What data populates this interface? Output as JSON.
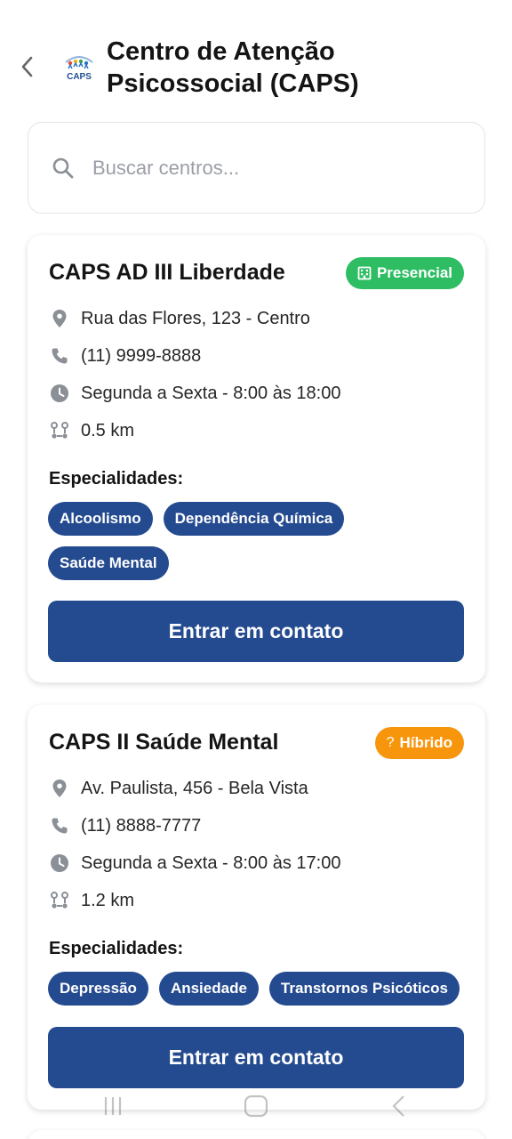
{
  "header": {
    "title": "Centro de Atenção Psicossocial (CAPS)",
    "logo_text": "CAPS"
  },
  "search": {
    "placeholder": "Buscar centros..."
  },
  "centers": [
    {
      "name": "CAPS AD III Liberdade",
      "mode": "Presencial",
      "mode_color": "#2ebd63",
      "address": "Rua das Flores, 123 - Centro",
      "phone": "(11) 9999-8888",
      "hours": "Segunda a Sexta - 8:00 às 18:00",
      "distance": "0.5 km",
      "specialties_label": "Especialidades:",
      "specialties": [
        "Alcoolismo",
        "Dependência Química",
        "Saúde Mental"
      ],
      "contact_label": "Entrar em contato"
    },
    {
      "name": "CAPS II Saúde Mental",
      "mode": "Híbrido",
      "mode_icon": "?",
      "mode_color": "#f7960d",
      "address": "Av. Paulista, 456 - Bela Vista",
      "phone": "(11) 8888-7777",
      "hours": "Segunda a Sexta - 8:00 às 17:00",
      "distance": "1.2 km",
      "specialties_label": "Especialidades:",
      "specialties": [
        "Depressão",
        "Ansiedade",
        "Transtornos Psicóticos"
      ],
      "contact_label": "Entrar em contato"
    }
  ],
  "colors": {
    "primary": "#244a8f",
    "presencial": "#2ebd63",
    "hibrido": "#f7960d"
  },
  "icons": [
    "back-arrow-icon",
    "search-icon",
    "location-pin-icon",
    "phone-icon",
    "clock-icon",
    "route-icon",
    "building-icon"
  ]
}
